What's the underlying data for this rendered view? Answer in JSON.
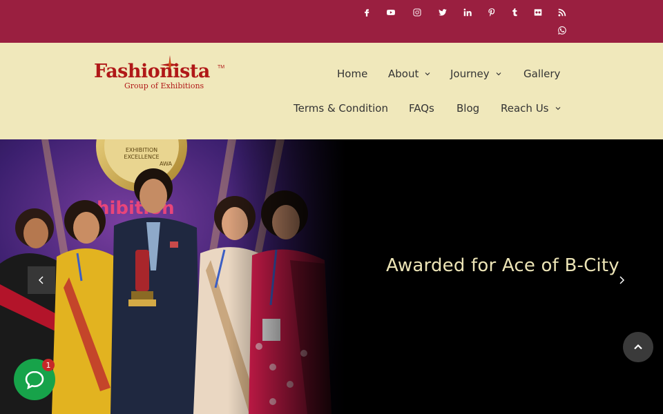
{
  "brand": {
    "logo_text": "Fashionista",
    "logo_sub": "Group of Exhibitions",
    "logo_tm": "TM"
  },
  "social": {
    "icons": [
      "facebook-icon",
      "youtube-icon",
      "instagram-icon",
      "twitter-icon",
      "linkedin-icon",
      "pinterest-icon",
      "tumblr-icon",
      "flickr-icon",
      "rss-icon",
      "whatsapp-icon"
    ]
  },
  "nav": {
    "home": "Home",
    "about": "About",
    "journey": "Journey",
    "gallery": "Gallery",
    "terms": "Terms & Condition",
    "faqs": "FAQs",
    "blog": "Blog",
    "reach_us": "Reach Us"
  },
  "hero": {
    "title": "Awarded for Ace of B-City"
  },
  "chat": {
    "badge_count": "1"
  },
  "colors": {
    "topbar": "#9a1f40",
    "header": "#f0e8bb",
    "brand_red": "#b01818",
    "hero_title": "#ece4b6",
    "chat_green": "#17a34a"
  }
}
